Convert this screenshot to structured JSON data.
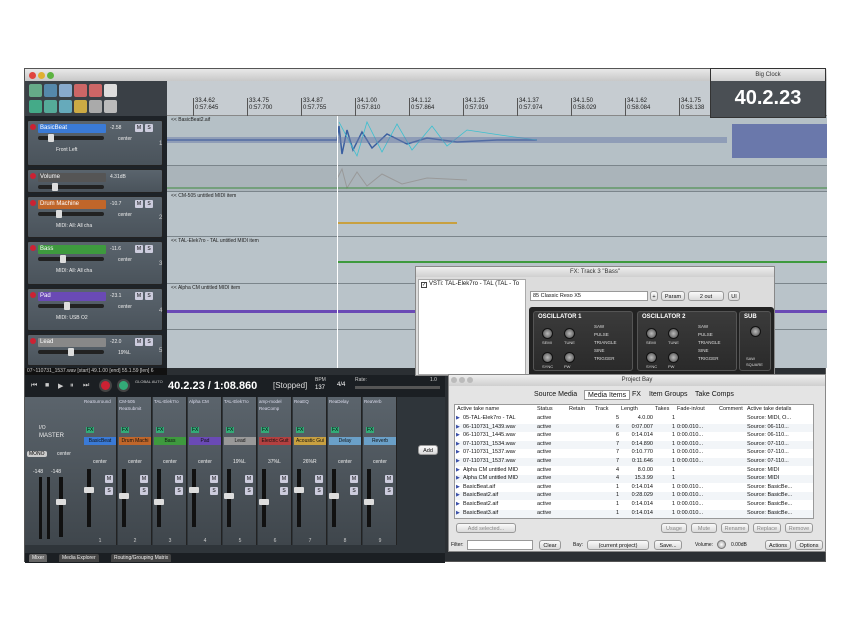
{
  "ruler": {
    "bars": [
      "33.4.62",
      "33.4.75",
      "33.4.87",
      "34.1.00",
      "34.1.12",
      "34.1.25",
      "34.1.37",
      "34.1.50",
      "34.1.62",
      "34.1.75",
      "34.1.87"
    ],
    "times": [
      "0:57.645",
      "0:57.700",
      "0:57.755",
      "0:57.810",
      "0:57.864",
      "0:57.919",
      "0:57.974",
      "0:58.029",
      "0:58.084",
      "0:58.138",
      "0:58.193"
    ]
  },
  "tracks": [
    {
      "name": "BasicBeat",
      "vol": "-2.58",
      "pan": "center",
      "extra": "Front Left",
      "num": "1",
      "color": "#3a7ad6"
    },
    {
      "name": "Volume",
      "vol": "4.31dB",
      "pan": "",
      "extra": "",
      "num": "",
      "color": "#555"
    },
    {
      "name": "Drum Machine",
      "vol": "-10.7",
      "pan": "center",
      "extra": "MIDI: All: All cha",
      "num": "2",
      "color": "#c0662a"
    },
    {
      "name": "Bass",
      "vol": "-11.6",
      "pan": "center",
      "extra": "MIDI: All: All cha",
      "num": "3",
      "color": "#3e9a3e"
    },
    {
      "name": "Pad",
      "vol": "-23.1",
      "pan": "center",
      "extra": "MIDI: USB O2",
      "num": "4",
      "color": "#6a4ab5"
    },
    {
      "name": "Lead",
      "vol": "-22.0",
      "pan": "19%L",
      "extra": "",
      "num": "5",
      "color": "#888"
    }
  ],
  "lanes": {
    "item1": "<< BasicBeat2.aif",
    "item2": "<< CM-505 untitled MIDI item",
    "item3": "<< TAL-Elek7ro - TAL untitled MIDI item",
    "item4": "<< Alpha CM untitled MIDI item"
  },
  "status_row": "07~110731_1537.wav [start] 49.1.00 [end] 55.1.59 [len] 6",
  "transport": {
    "position": "40.2.23 / 1:08.860",
    "state": "[Stopped]",
    "bpm_label": "BPM",
    "bpm": "137",
    "sig": "4/4",
    "rate_label": "Rate:",
    "rate": "1.0",
    "global_auto": "GLOBAL AUTO"
  },
  "master": {
    "label": "MASTER",
    "mono": "MONO",
    "pan": "center",
    "io": "I/O",
    "peaks": [
      "-148",
      "-148"
    ]
  },
  "strips": [
    {
      "name": "BasicBeat",
      "fx": [
        "ReaSurround"
      ],
      "pan": "center",
      "num": "1",
      "color": "#3a7ad6"
    },
    {
      "name": "Drum Machi",
      "fx": [
        "CM-505",
        "ReaSubmit"
      ],
      "pan": "center",
      "num": "2",
      "color": "#c0662a"
    },
    {
      "name": "Bass",
      "fx": [
        "TAL-Elek7ro"
      ],
      "pan": "center",
      "num": "3",
      "color": "#3e9a3e"
    },
    {
      "name": "Pad",
      "fx": [
        "Alpha CM"
      ],
      "pan": "center",
      "num": "4",
      "color": "#6a4ab5"
    },
    {
      "name": "Lead",
      "fx": [
        "TAL-Elek7ro"
      ],
      "pan": "19%L",
      "num": "5",
      "color": "#999"
    },
    {
      "name": "Electric Guit",
      "fx": [
        "amp-model",
        "ReaComp"
      ],
      "pan": "37%L",
      "num": "6",
      "color": "#b34040"
    },
    {
      "name": "Acoustic Gui",
      "fx": [
        "ReaEQ"
      ],
      "pan": "26%R",
      "num": "7",
      "color": "#c8a040"
    },
    {
      "name": "Delay",
      "fx": [
        "ReaDelay"
      ],
      "pan": "center",
      "num": "8",
      "color": "#6aa0c8"
    },
    {
      "name": "Reverb",
      "fx": [
        "ReaVerb"
      ],
      "pan": "center",
      "num": "9",
      "color": "#6aa0c8"
    }
  ],
  "bottom_tabs": [
    "Mixer",
    "Media Explorer",
    "Routing/Grouping Matrix"
  ],
  "bigclock": {
    "title": "Big Clock",
    "time": "40.2.23"
  },
  "fx": {
    "title": "FX: Track 3 \"Bass\"",
    "plugin": "VSTi: TAL-Elek7ro - TAL (TAL - To",
    "preset": "85 Classic Reso X5",
    "param": "Param",
    "out": "2 out",
    "ui": "UI",
    "add": "Add",
    "cpu": "0.5%/0.5%",
    "osc1": "OSCILLATOR 1",
    "osc2": "OSCILLATOR 2",
    "sub": "SUB",
    "knobs": [
      "SEMI",
      "TUNE",
      "SYNC",
      "PW"
    ],
    "waves": [
      "SAW",
      "PULSE",
      "TRIANGLE",
      "SINE",
      "TRIGGER"
    ],
    "sub_waves": [
      "SAW",
      "SQUARE"
    ]
  },
  "projectbay": {
    "title": "Project Bay",
    "tabs": [
      "Source Media",
      "Media Items",
      "FX",
      "Item Groups",
      "Take Comps"
    ],
    "headers": [
      "Active take name",
      "Status",
      "Retain",
      "Track",
      "Length",
      "Takes",
      "Fade-in/out",
      "Comment",
      "Active take details"
    ],
    "rows": [
      [
        "05-TAL-Elek7ro - TAL",
        "active",
        "",
        "5",
        "4.0.00",
        "1",
        "",
        "",
        "Source: MIDI, O..."
      ],
      [
        "06-110731_1439.wav",
        "active",
        "",
        "6",
        "0:07.007",
        "1",
        "0:00.010...",
        "",
        "Source: 06-110..."
      ],
      [
        "06-110731_1445.wav",
        "active",
        "",
        "6",
        "0:14.014",
        "1",
        "0:00.010...",
        "",
        "Source: 06-110..."
      ],
      [
        "07-110731_1534.wav",
        "active",
        "",
        "7",
        "0:14.890",
        "1",
        "0:00.010...",
        "",
        "Source: 07-110..."
      ],
      [
        "07-110731_1537.wav",
        "active",
        "",
        "7",
        "0:10.770",
        "1",
        "0:00.010...",
        "",
        "Source: 07-110..."
      ],
      [
        "07-110731_1537.wav",
        "active",
        "",
        "7",
        "0:11.646",
        "1",
        "0:00.010...",
        "",
        "Source: 07-110..."
      ],
      [
        "Alpha CM untitled MID",
        "active",
        "",
        "4",
        "8.0.00",
        "1",
        "",
        "",
        "Source: MIDI"
      ],
      [
        "Alpha CM untitled MID",
        "active",
        "",
        "4",
        "15.3.99",
        "1",
        "",
        "",
        "Source: MIDI"
      ],
      [
        "BasicBeat.aif",
        "active",
        "",
        "1",
        "0:14.014",
        "1",
        "0:00.010...",
        "",
        "Source: BasicBe..."
      ],
      [
        "BasicBeat2.aif",
        "active",
        "",
        "1",
        "0:28.029",
        "1",
        "0:00.010...",
        "",
        "Source: BasicBe..."
      ],
      [
        "BasicBeat2.aif",
        "active",
        "",
        "1",
        "0:14.014",
        "1",
        "0:00.010...",
        "",
        "Source: BasicBe..."
      ],
      [
        "BasicBeat3.aif",
        "active",
        "",
        "1",
        "0:14.014",
        "1",
        "0:00.010...",
        "",
        "Source: BasicBe..."
      ]
    ],
    "buttons": [
      "Add selected...",
      "Usage",
      "Mute",
      "Rename",
      "Replace",
      "Remove"
    ],
    "filter_label": "Filter:",
    "clear": "Clear",
    "bay_label": "Bay:",
    "bay_value": "(current project)",
    "save": "Save...",
    "volume_label": "Volume:",
    "volume": "0.00dB",
    "actions": "Actions",
    "options": "Options"
  }
}
